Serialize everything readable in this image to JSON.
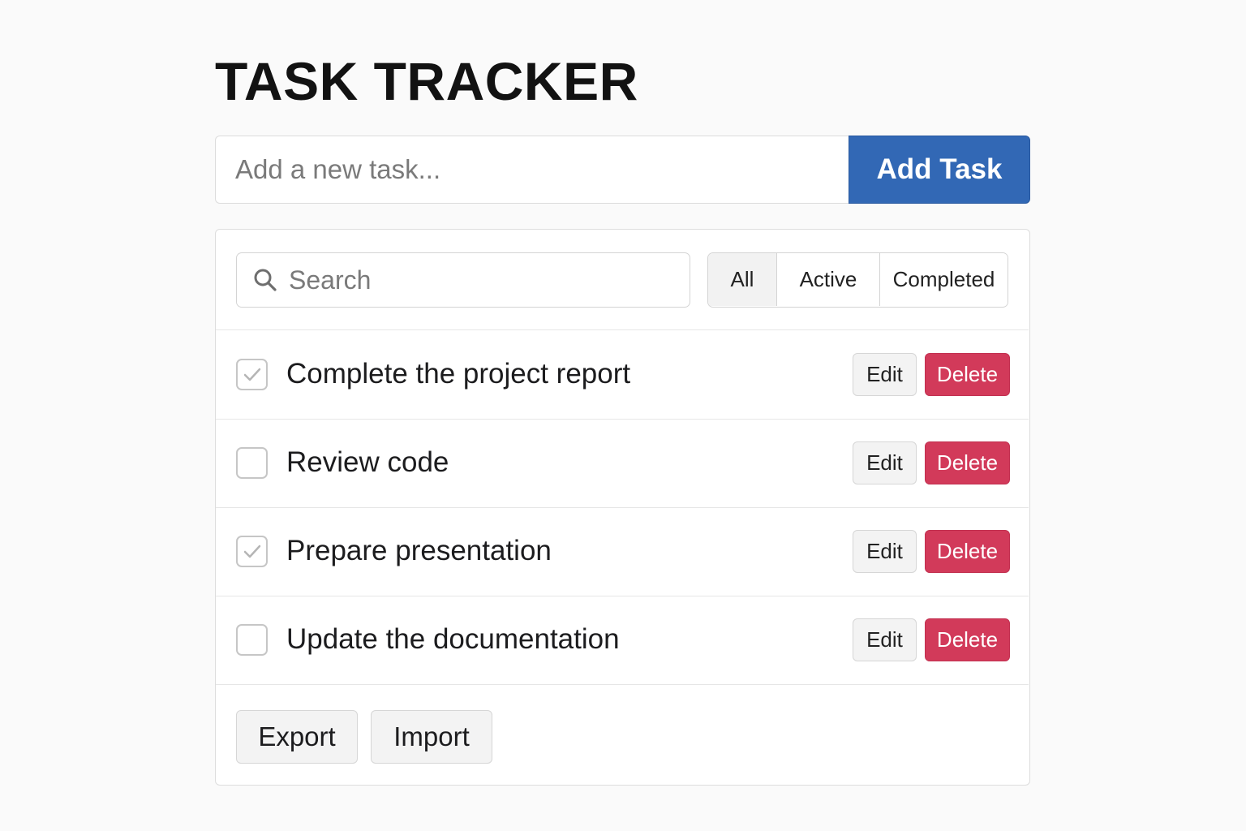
{
  "header": {
    "title": "TASK TRACKER"
  },
  "new_task": {
    "placeholder": "Add a new task...",
    "add_label": "Add Task"
  },
  "search": {
    "placeholder": "Search",
    "icon": "search-icon"
  },
  "filters": [
    {
      "label": "All",
      "selected": true
    },
    {
      "label": "Active",
      "selected": false
    },
    {
      "label": "Completed",
      "selected": false
    }
  ],
  "tasks": [
    {
      "label": "Complete the project report",
      "checked": true,
      "edit_label": "Edit",
      "delete_label": "Delete"
    },
    {
      "label": "Review code",
      "checked": false,
      "edit_label": "Edit",
      "delete_label": "Delete"
    },
    {
      "label": "Prepare presentation",
      "checked": true,
      "edit_label": "Edit",
      "delete_label": "Delete"
    },
    {
      "label": "Update the documentation",
      "checked": false,
      "edit_label": "Edit",
      "delete_label": "Delete"
    }
  ],
  "footer": {
    "export_label": "Export",
    "import_label": "Import"
  },
  "colors": {
    "primary": "#3268b5",
    "danger": "#d23a5a",
    "check": "#b5b5b5"
  }
}
